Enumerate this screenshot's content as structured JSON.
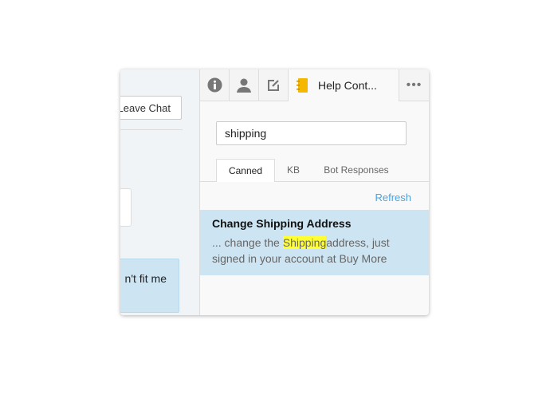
{
  "left": {
    "leave_chat": "Leave Chat",
    "message_fragment": "n't fit me"
  },
  "tabs": [
    {
      "icon": "info-icon"
    },
    {
      "icon": "user-icon"
    },
    {
      "icon": "edit-icon"
    },
    {
      "icon": "notebook-icon",
      "label": "Help Cont..."
    },
    {
      "icon": "more-icon",
      "label": "•••"
    }
  ],
  "search": {
    "value": "shipping"
  },
  "subtabs": [
    {
      "label": "Canned",
      "active": true
    },
    {
      "label": "KB"
    },
    {
      "label": "Bot Responses"
    }
  ],
  "refresh": "Refresh",
  "result": {
    "title": "Change Shipping Address",
    "prefix": "... change the ",
    "highlight": "Shipping",
    "suffix": "address, just signed in your account at Buy More"
  },
  "colors": {
    "accent": "#4aa3df",
    "highlight": "#ffff33",
    "selected": "#cde5f3",
    "notebook": "#f5b800"
  }
}
